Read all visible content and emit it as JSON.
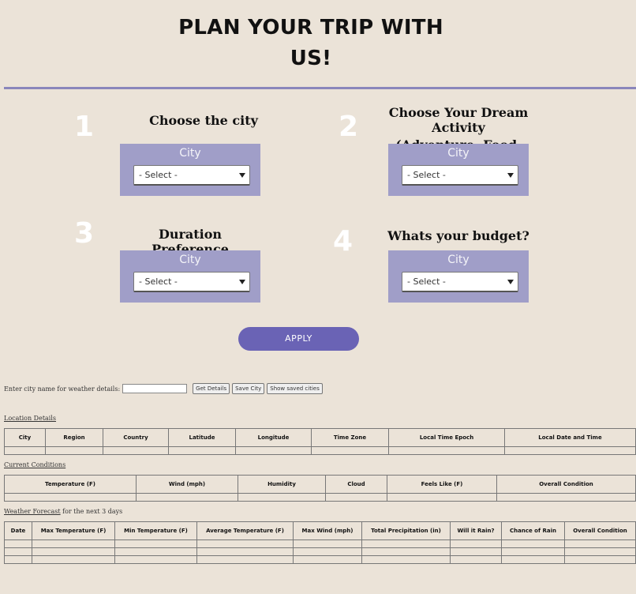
{
  "header": {
    "title_line1": "PLAN YOUR TRIP WITH",
    "title_line2": "US!"
  },
  "steps": [
    {
      "number": "1",
      "title": "Choose the city",
      "card_label": "City",
      "select_value": "- Select -"
    },
    {
      "number": "2",
      "title_line1": "Choose Your Dream Activity",
      "title_line2": "(Adventure, Food, Relaxation)",
      "card_label": "City",
      "select_value": "- Select -"
    },
    {
      "number": "3",
      "title": "Duration Preference",
      "card_label": "City",
      "select_value": "- Select -"
    },
    {
      "number": "4",
      "title": "Whats your budget?",
      "card_label": "City",
      "select_value": "- Select -"
    }
  ],
  "apply_label": "APPLY",
  "weather": {
    "prompt": "Enter city name for weather details:",
    "input_value": "",
    "get_details": "Get Details",
    "save_city": "Save City",
    "show_saved": "Show saved cities"
  },
  "location": {
    "label": "Location Details",
    "columns": [
      "City",
      "Region",
      "Country",
      "Latitude",
      "Longitude",
      "Time Zone",
      "Local Time Epoch",
      "Local Date and Time"
    ]
  },
  "current": {
    "label": "Current Conditions",
    "columns": [
      "Temperature (F)",
      "Wind (mph)",
      "Humidity",
      "Cloud",
      "Feels Like (F)",
      "Overall Condition"
    ]
  },
  "forecast": {
    "label_link": "Weather Forecast",
    "label_rest": " for the next 3 days",
    "columns": [
      "Date",
      "Max Temperature (F)",
      "Min Temperature (F)",
      "Average Temperature (F)",
      "Max Wind (mph)",
      "Total Precipitation (in)",
      "Will it Rain?",
      "Chance of Rain",
      "Overall Condition"
    ]
  },
  "colors": {
    "background": "#ebe3d8",
    "card": "#a09ec8",
    "apply": "#6a63b5",
    "divider": "#8a86bb"
  }
}
